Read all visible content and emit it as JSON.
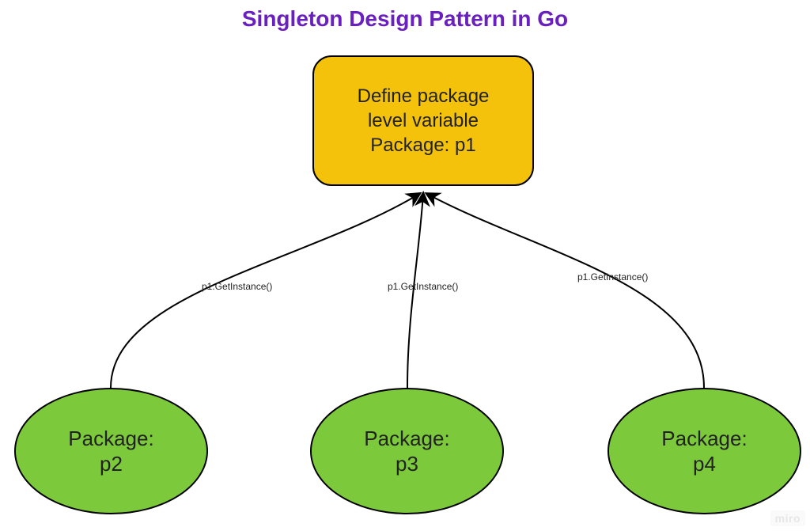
{
  "title": "Singleton Design Pattern in Go",
  "colors": {
    "title": "#6a1fbf",
    "topBoxFill": "#f5c20b",
    "ellipseFill": "#7cc93c",
    "stroke": "#000000"
  },
  "nodes": {
    "top": {
      "line1": "Define package",
      "line2": "level variable",
      "line3": "Package: p1"
    },
    "p2": {
      "line1": "Package:",
      "line2": "p2"
    },
    "p3": {
      "line1": "Package:",
      "line2": "p3"
    },
    "p4": {
      "line1": "Package:",
      "line2": "p4"
    }
  },
  "edges": {
    "fromP2": "p1.GetInstance()",
    "fromP3": "p1.GetInstance()",
    "fromP4": "p1.GetInstance()"
  },
  "watermark": "miro"
}
